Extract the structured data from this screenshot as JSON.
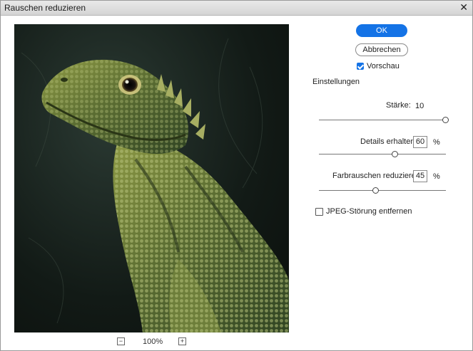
{
  "window": {
    "title": "Rauschen reduzieren",
    "close_glyph": "✕"
  },
  "preview": {
    "zoom_out_glyph": "−",
    "zoom_label": "100%",
    "zoom_in_glyph": "+"
  },
  "buttons": {
    "ok_label": "OK",
    "cancel_label": "Abbrechen"
  },
  "vorschau": {
    "label": "Vorschau",
    "checked": true
  },
  "settings": {
    "heading": "Einstellungen",
    "staerke": {
      "label": "Stärke:",
      "value": "10",
      "slider_fraction": 1.0
    },
    "details": {
      "label": "Details erhalten:",
      "value": "60",
      "unit": "%",
      "slider_fraction": 0.6
    },
    "farbrauschen": {
      "label": "Farbrauschen reduzieren:",
      "value": "45",
      "unit": "%",
      "slider_fraction": 0.45
    },
    "jpeg": {
      "label": "JPEG-Störung entfernen",
      "checked": false
    }
  },
  "colors": {
    "accent": "#1473e6"
  }
}
